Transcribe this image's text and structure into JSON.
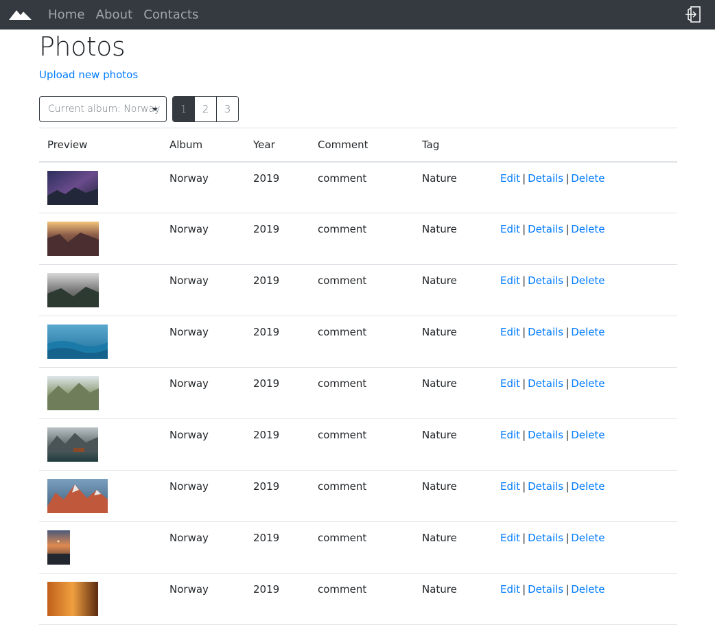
{
  "nav": {
    "links": [
      {
        "label": "Home"
      },
      {
        "label": "About"
      },
      {
        "label": "Contacts"
      }
    ]
  },
  "page": {
    "title": "Photos",
    "upload_link": "Upload new photos"
  },
  "album_select": {
    "label": "Current album: Norway"
  },
  "pagination": {
    "pages": [
      "1",
      "2",
      "3"
    ],
    "active": "1"
  },
  "table": {
    "headers": [
      "Preview",
      "Album",
      "Year",
      "Comment",
      "Tag"
    ],
    "rows": [
      {
        "album": "Norway",
        "year": "2019",
        "comment": "comment",
        "tag": "Nature",
        "edit": "Edit",
        "sep1": "|",
        "details": "Details",
        "sep2": "|",
        "delete": "Delete"
      },
      {
        "album": "Norway",
        "year": "2019",
        "comment": "comment",
        "tag": "Nature",
        "edit": "Edit",
        "sep1": "|",
        "details": "Details",
        "sep2": "|",
        "delete": "Delete"
      },
      {
        "album": "Norway",
        "year": "2019",
        "comment": "comment",
        "tag": "Nature",
        "edit": "Edit",
        "sep1": "|",
        "details": "Details",
        "sep2": "|",
        "delete": "Delete"
      },
      {
        "album": "Norway",
        "year": "2019",
        "comment": "comment",
        "tag": "Nature",
        "edit": "Edit",
        "sep1": "|",
        "details": "Details",
        "sep2": "|",
        "delete": "Delete"
      },
      {
        "album": "Norway",
        "year": "2019",
        "comment": "comment",
        "tag": "Nature",
        "edit": "Edit",
        "sep1": "|",
        "details": "Details",
        "sep2": "|",
        "delete": "Delete"
      },
      {
        "album": "Norway",
        "year": "2019",
        "comment": "comment",
        "tag": "Nature",
        "edit": "Edit",
        "sep1": "|",
        "details": "Details",
        "sep2": "|",
        "delete": "Delete"
      },
      {
        "album": "Norway",
        "year": "2019",
        "comment": "comment",
        "tag": "Nature",
        "edit": "Edit",
        "sep1": "|",
        "details": "Details",
        "sep2": "|",
        "delete": "Delete"
      },
      {
        "album": "Norway",
        "year": "2019",
        "comment": "comment",
        "tag": "Nature",
        "edit": "Edit",
        "sep1": "|",
        "details": "Details",
        "sep2": "|",
        "delete": "Delete"
      },
      {
        "album": "Norway",
        "year": "2019",
        "comment": "comment",
        "tag": "Nature",
        "edit": "Edit",
        "sep1": "|",
        "details": "Details",
        "sep2": "|",
        "delete": "Delete"
      }
    ]
  },
  "colors": {
    "navbar_bg": "#343a40",
    "link": "#007bff",
    "border": "#dee2e6"
  },
  "icons": {
    "brand": "mountain-logo-icon",
    "login": "sign-in-icon"
  }
}
